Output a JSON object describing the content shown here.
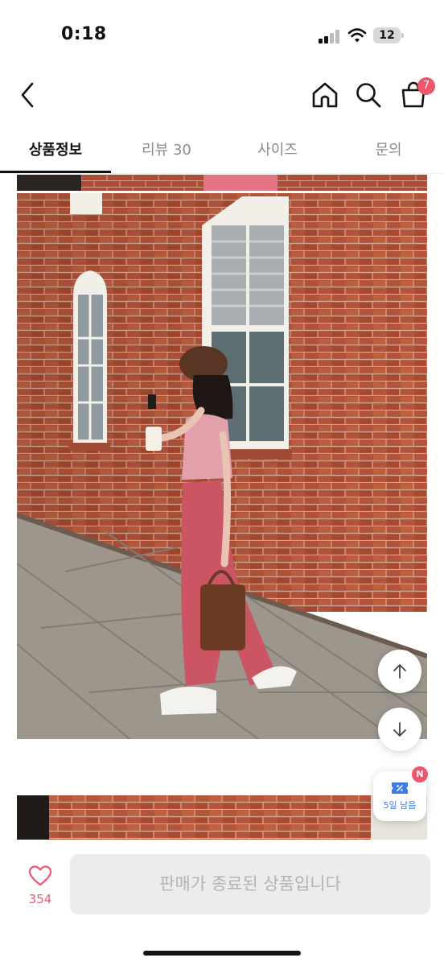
{
  "status_bar": {
    "time": "0:18",
    "battery_level": "12"
  },
  "header": {
    "cart_badge": "7"
  },
  "tabs": [
    {
      "label": "상품정보",
      "active": true
    },
    {
      "label": "리뷰 30",
      "active": false
    },
    {
      "label": "사이즈",
      "active": false
    },
    {
      "label": "문의",
      "active": false
    }
  ],
  "coupon": {
    "badge": "N",
    "label": "5일 남음"
  },
  "bottom": {
    "like_count": "354",
    "sold_out_label": "판매가 종료된 상품입니다"
  },
  "colors": {
    "accent": "#f0566b",
    "brick": "#b4523a",
    "pants": "#d45a68",
    "coupon": "#3b7be8"
  },
  "icons": [
    "back-icon",
    "home-icon",
    "search-icon",
    "cart-icon",
    "arrow-up-icon",
    "arrow-down-icon",
    "coupon-icon",
    "heart-icon"
  ]
}
